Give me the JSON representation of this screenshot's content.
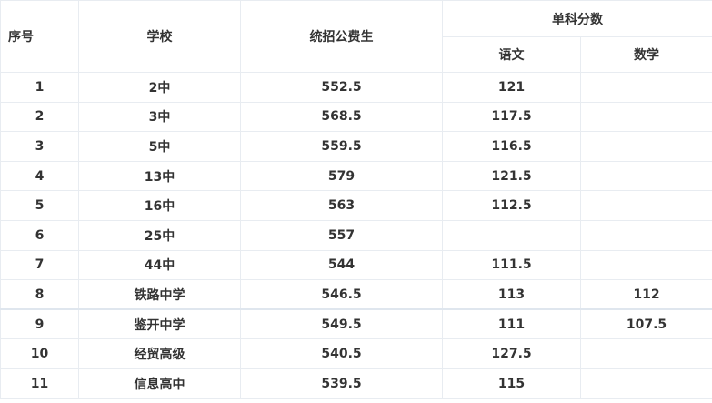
{
  "table": {
    "headers": {
      "index": "序号",
      "school": "学校",
      "public_score": "统招公费生",
      "subject_group": "单科分数",
      "chinese": "语文",
      "math": "数学"
    },
    "rows": [
      {
        "index": "1",
        "school": "2中",
        "public_score": "552.5",
        "chinese": "121",
        "math": ""
      },
      {
        "index": "2",
        "school": "3中",
        "public_score": "568.5",
        "chinese": "117.5",
        "math": ""
      },
      {
        "index": "3",
        "school": "5中",
        "public_score": "559.5",
        "chinese": "116.5",
        "math": ""
      },
      {
        "index": "4",
        "school": "13中",
        "public_score": "579",
        "chinese": "121.5",
        "math": ""
      },
      {
        "index": "5",
        "school": "16中",
        "public_score": "563",
        "chinese": "112.5",
        "math": ""
      },
      {
        "index": "6",
        "school": "25中",
        "public_score": "557",
        "chinese": "",
        "math": ""
      },
      {
        "index": "7",
        "school": "44中",
        "public_score": "544",
        "chinese": "111.5",
        "math": ""
      },
      {
        "index": "8",
        "school": "铁路中学",
        "public_score": "546.5",
        "chinese": "113",
        "math": "112"
      },
      {
        "index": "9",
        "school": "鉴开中学",
        "public_score": "549.5",
        "chinese": "111",
        "math": "107.5"
      },
      {
        "index": "10",
        "school": "经贸高级",
        "public_score": "540.5",
        "chinese": "127.5",
        "math": ""
      },
      {
        "index": "11",
        "school": "信息高中",
        "public_score": "539.5",
        "chinese": "115",
        "math": ""
      }
    ]
  },
  "colors": {
    "border": "#e8ecf1",
    "text": "#333333"
  }
}
